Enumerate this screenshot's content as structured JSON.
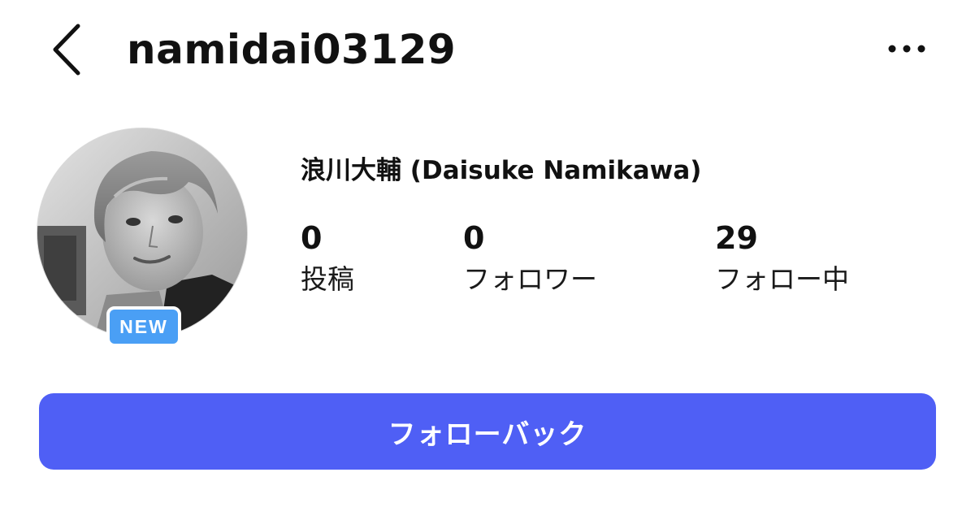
{
  "header": {
    "username": "namidai03129",
    "back_icon": "chevron-left-icon",
    "more_icon": "more-horizontal-icon"
  },
  "profile": {
    "display_name": "浪川大輔 (Daisuke Namikawa)",
    "new_badge": "NEW",
    "stats": {
      "posts": {
        "value": "0",
        "label": "投稿"
      },
      "followers": {
        "value": "0",
        "label": "フォロワー"
      },
      "following": {
        "value": "29",
        "label": "フォロー中"
      }
    }
  },
  "actions": {
    "follow_back_label": "フォローバック"
  },
  "colors": {
    "primary_button": "#4f5ff5",
    "new_badge": "#4a9ff5",
    "text": "#111111",
    "background": "#ffffff"
  }
}
